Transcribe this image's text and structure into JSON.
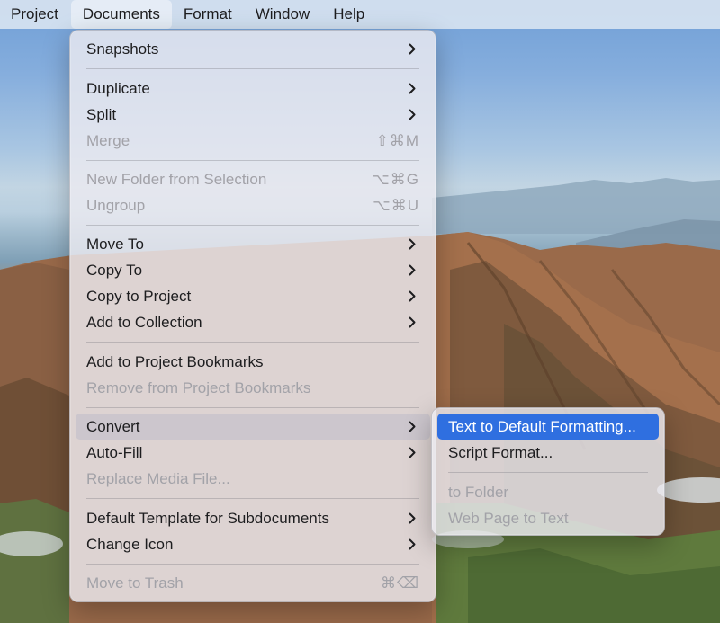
{
  "menubar": {
    "items": [
      "Project",
      "Documents",
      "Format",
      "Window",
      "Help"
    ]
  },
  "documents_menu": {
    "items": {
      "snapshots": "Snapshots",
      "duplicate": "Duplicate",
      "split": "Split",
      "merge": "Merge",
      "merge_shortcut": "⇧⌘M",
      "new_folder": "New Folder from Selection",
      "new_folder_shortcut": "⌥⌘G",
      "ungroup": "Ungroup",
      "ungroup_shortcut": "⌥⌘U",
      "move_to": "Move To",
      "copy_to": "Copy To",
      "copy_to_project": "Copy to Project",
      "add_to_collection": "Add to Collection",
      "add_bookmarks": "Add to Project Bookmarks",
      "remove_bookmarks": "Remove from Project Bookmarks",
      "convert": "Convert",
      "auto_fill": "Auto-Fill",
      "replace_media": "Replace Media File...",
      "default_template": "Default Template for Subdocuments",
      "change_icon": "Change Icon",
      "move_to_trash": "Move to Trash",
      "trash_shortcut": "⌘⌫"
    }
  },
  "convert_submenu": {
    "items": {
      "text_default": "Text to Default Formatting...",
      "script_format": "Script Format...",
      "to_folder": "to Folder",
      "web_page": "Web Page to Text"
    }
  },
  "colors": {
    "selection": "#2f6fe0",
    "disabled_text": "#a2a2a8"
  }
}
